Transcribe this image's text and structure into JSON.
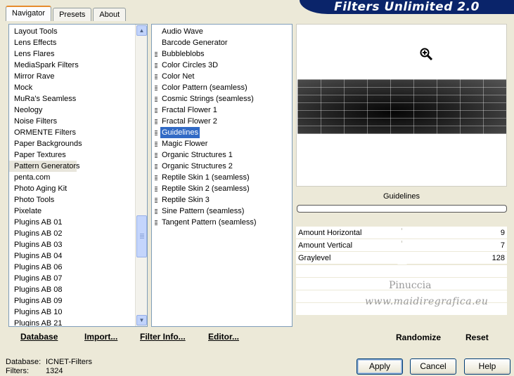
{
  "app": {
    "title": "Filters Unlimited 2.0"
  },
  "tabs": [
    {
      "label": "Navigator",
      "active": true
    },
    {
      "label": "Presets",
      "active": false
    },
    {
      "label": "About",
      "active": false
    }
  ],
  "categories": {
    "items": [
      "Layout Tools",
      "Lens Effects",
      "Lens Flares",
      "MediaSpark Filters",
      "Mirror Rave",
      "Mock",
      "MuRa's Seamless",
      "Neology",
      "Noise Filters",
      "ORMENTE Filters",
      "Paper Backgrounds",
      "Paper Textures",
      "Pattern Generators",
      "penta.com",
      "Photo Aging Kit",
      "Photo Tools",
      "Pixelate",
      "Plugins AB 01",
      "Plugins AB 02",
      "Plugins AB 03",
      "Plugins AB 04",
      "Plugins AB 06",
      "Plugins AB 07",
      "Plugins AB 08",
      "Plugins AB 09",
      "Plugins AB 10",
      "Plugins AB 21"
    ],
    "selected": "Pattern Generators"
  },
  "filters": {
    "items": [
      {
        "label": "Audio Wave",
        "bullet": false
      },
      {
        "label": "Barcode Generator",
        "bullet": false
      },
      {
        "label": "Bubbleblobs",
        "bullet": true
      },
      {
        "label": "Color Circles 3D",
        "bullet": true
      },
      {
        "label": "Color Net",
        "bullet": true
      },
      {
        "label": "Color Pattern (seamless)",
        "bullet": true
      },
      {
        "label": "Cosmic Strings (seamless)",
        "bullet": true
      },
      {
        "label": "Fractal Flower 1",
        "bullet": true
      },
      {
        "label": "Fractal Flower 2",
        "bullet": true
      },
      {
        "label": "Guidelines",
        "bullet": true
      },
      {
        "label": "Magic Flower",
        "bullet": true
      },
      {
        "label": "Organic Structures 1",
        "bullet": true
      },
      {
        "label": "Organic Structures 2",
        "bullet": true
      },
      {
        "label": "Reptile Skin 1 (seamless)",
        "bullet": true
      },
      {
        "label": "Reptile Skin 2 (seamless)",
        "bullet": true
      },
      {
        "label": "Reptile Skin 3",
        "bullet": true
      },
      {
        "label": "Sine Pattern (seamless)",
        "bullet": true
      },
      {
        "label": "Tangent Pattern (seamless)",
        "bullet": true
      }
    ],
    "selected": "Guidelines"
  },
  "toolbar": {
    "database": "Database",
    "import": "Import...",
    "filter_info": "Filter Info...",
    "editor": "Editor..."
  },
  "preview": {
    "zoom_icon": "zoom-in-icon"
  },
  "filter_panel": {
    "title": "Guidelines",
    "params": [
      {
        "name": "Amount Horizontal",
        "value": "9"
      },
      {
        "name": "Amount Vertical",
        "value": "7"
      },
      {
        "name": "Graylevel",
        "value": "128"
      }
    ],
    "randomize": "Randomize",
    "reset": "Reset"
  },
  "watermark": {
    "line1": "Pinuccia",
    "line2": "www.maidiregrafica.eu"
  },
  "status": {
    "database_label": "Database:",
    "database_value": "ICNET-Filters",
    "filters_label": "Filters:",
    "filters_value": "1324"
  },
  "buttons": {
    "apply": "Apply",
    "cancel": "Cancel",
    "help": "Help"
  },
  "colors": {
    "accent": "#316ac5",
    "banner": "#0a246a",
    "face": "#ece9d8"
  }
}
